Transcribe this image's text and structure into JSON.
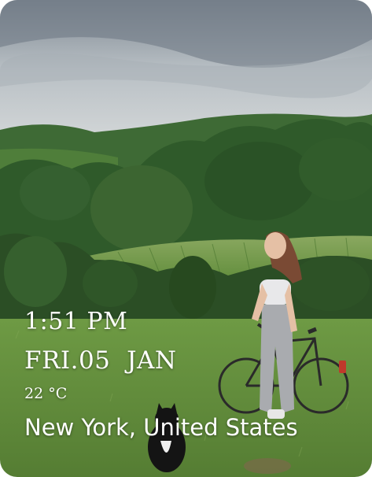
{
  "widget": {
    "time": "1:51 PM",
    "date": "FRI.05  JAN",
    "temperature": "22 °C",
    "location": "New York, United States"
  },
  "background": {
    "icon": "landscape-photo",
    "colors": {
      "sky": "#cfd4d6",
      "trees": "#2f5a2a",
      "grass": "#6f9a45"
    }
  }
}
